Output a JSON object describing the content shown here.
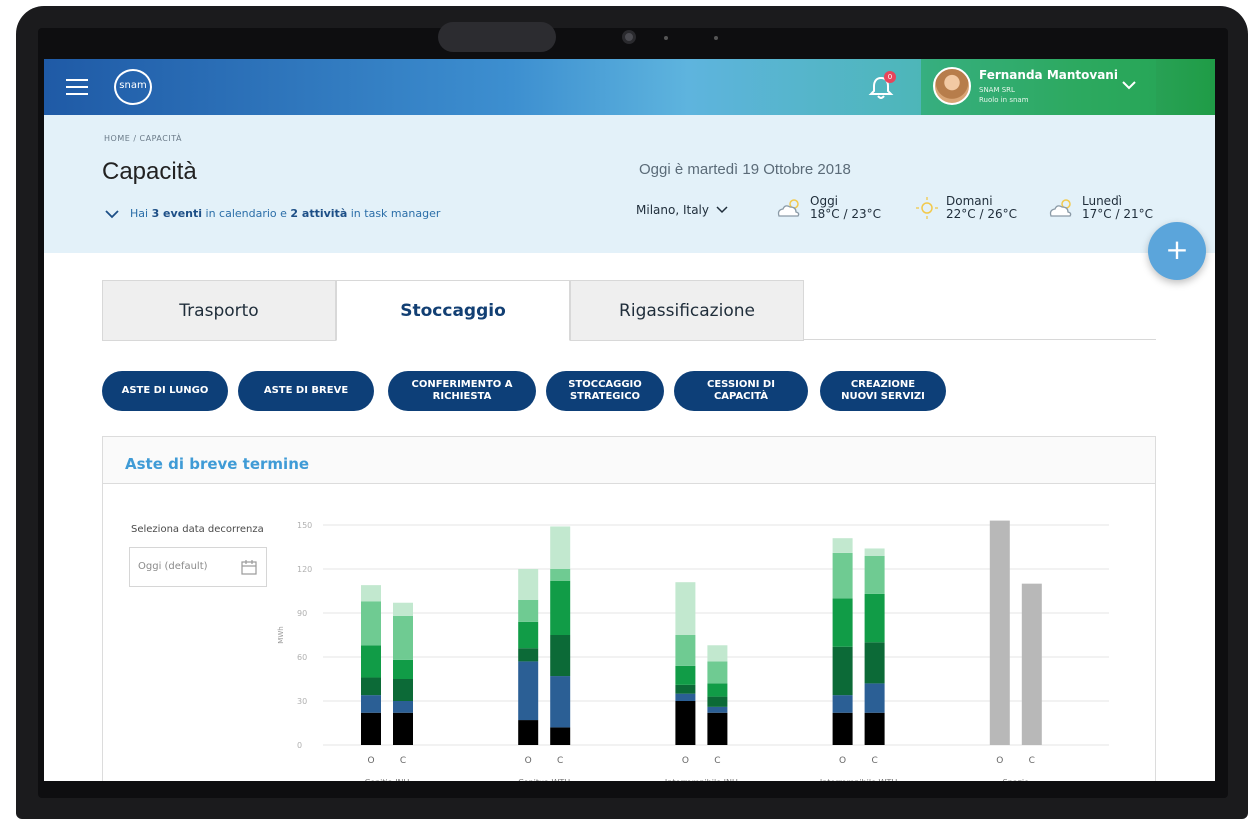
{
  "topbar": {
    "logo_text": "snam",
    "notification_count": "0",
    "user": {
      "name": "Fernanda Mantovani",
      "company": "SNAM SRL",
      "role": "Ruolo in snam"
    }
  },
  "header": {
    "breadcrumb": "HOME  /  CAPACITÀ",
    "title": "Capacità",
    "events_prefix": "Hai ",
    "events_count": "3 eventi",
    "events_middle": " in calendario e ",
    "tasks_count": "2 attività",
    "events_suffix": " in task manager",
    "date_line": "Oggi è martedì 19 Ottobre 2018",
    "location": "Milano, Italy",
    "weather": [
      {
        "day": "Oggi",
        "temp": "18°C / 23°C",
        "icon": "partly-cloudy-icon"
      },
      {
        "day": "Domani",
        "temp": "22°C / 26°C",
        "icon": "sun-icon"
      },
      {
        "day": "Lunedì",
        "temp": "17°C / 21°C",
        "icon": "partly-cloudy-icon"
      }
    ]
  },
  "tabs": [
    "Trasporto",
    "Stoccaggio",
    "Rigassificazione"
  ],
  "active_tab": "Stoccaggio",
  "buttons": [
    "ASTE DI LUNGO",
    "ASTE DI BREVE",
    "CONFERIMENTO A\nRICHIESTA",
    "STOCCAGGIO\nSTRATEGICO",
    "CESSIONI DI\nCAPACITÀ",
    "CREAZIONE\nNUOVI SERVIZI"
  ],
  "card": {
    "title": "Aste di breve termine",
    "date_label": "Seleziona data decorrenza",
    "date_value": "Oggi (default)"
  },
  "colors": {
    "black": "#000000",
    "blue": "#2b5f95",
    "dark_green": "#0c6a37",
    "green": "#119c47",
    "mid_green": "#6fcb92",
    "light_green": "#c2e8cf",
    "gray": "#b8b8b8"
  },
  "chart_data": {
    "type": "bar",
    "ylabel": "MWh",
    "ylim": [
      0,
      150
    ],
    "yticks": [
      0,
      30,
      60,
      90,
      120,
      150
    ],
    "groups": [
      "Conitia INU",
      "Conitua WTH",
      "Interrompibile INU",
      "Interrompibile WTH",
      "Spazio"
    ],
    "sub_labels": [
      "O",
      "C"
    ],
    "bars": [
      {
        "group": "Conitia INU",
        "sub": "O",
        "segments": [
          22,
          12,
          12,
          22,
          30,
          11
        ]
      },
      {
        "group": "Conitia INU",
        "sub": "C",
        "segments": [
          22,
          8,
          15,
          13,
          30,
          9
        ]
      },
      {
        "group": "Conitua WTH",
        "sub": "O",
        "segments": [
          17,
          40,
          9,
          18,
          15,
          21
        ]
      },
      {
        "group": "Conitua WTH",
        "sub": "C",
        "segments": [
          12,
          35,
          28,
          37,
          8,
          29
        ]
      },
      {
        "group": "Interrompibile INU",
        "sub": "O",
        "segments": [
          30,
          5,
          6,
          13,
          21,
          36
        ]
      },
      {
        "group": "Interrompibile INU",
        "sub": "C",
        "segments": [
          22,
          4,
          7,
          9,
          15,
          11
        ]
      },
      {
        "group": "Interrompibile WTH",
        "sub": "O",
        "segments": [
          22,
          12,
          33,
          33,
          31,
          10
        ]
      },
      {
        "group": "Interrompibile WTH",
        "sub": "C",
        "segments": [
          22,
          20,
          28,
          33,
          26,
          5
        ]
      },
      {
        "group": "Spazio",
        "sub": "O",
        "segments": [
          153
        ]
      },
      {
        "group": "Spazio",
        "sub": "C",
        "segments": [
          110
        ]
      }
    ],
    "segment_colors": [
      "#000000",
      "#2b5f95",
      "#0c6a37",
      "#119c47",
      "#6fcb92",
      "#c2e8cf"
    ],
    "spazio_color": "#b8b8b8"
  }
}
